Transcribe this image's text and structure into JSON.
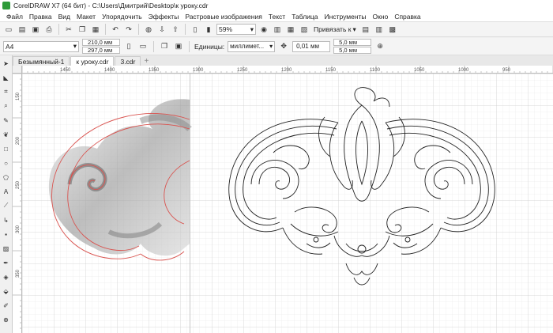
{
  "window": {
    "title": "CorelDRAW X7 (64 бит) - C:\\Users\\Дмитрий\\Desktop\\к уроку.cdr"
  },
  "menu": [
    "Файл",
    "Правка",
    "Вид",
    "Макет",
    "Упорядочить",
    "Эффекты",
    "Растровые изображения",
    "Текст",
    "Таблица",
    "Инструменты",
    "Окно",
    "Справка"
  ],
  "toolbar": {
    "zoom": "59%",
    "snap_label": "Привязать к"
  },
  "property_bar": {
    "page_size": "A4",
    "width": "210,0 мм",
    "height": "297,0 мм",
    "units_label": "Единицы:",
    "units": "миллимет...",
    "nudge": "0,01 мм",
    "dup_x": "5,0 мм",
    "dup_y": "5,0 мм"
  },
  "tabs": [
    "Безымянный-1",
    "к уроку.cdr",
    "3.cdr"
  ],
  "hruler_labels": [
    "1450",
    "1400",
    "1350",
    "1300",
    "1250",
    "1200",
    "1150",
    "1100",
    "1050",
    "1000",
    "950"
  ],
  "vruler_labels": [
    "150",
    "200",
    "250",
    "300",
    "350"
  ],
  "colors": {
    "accent_red": "#d9534f",
    "grid": "#dcdcdc"
  }
}
